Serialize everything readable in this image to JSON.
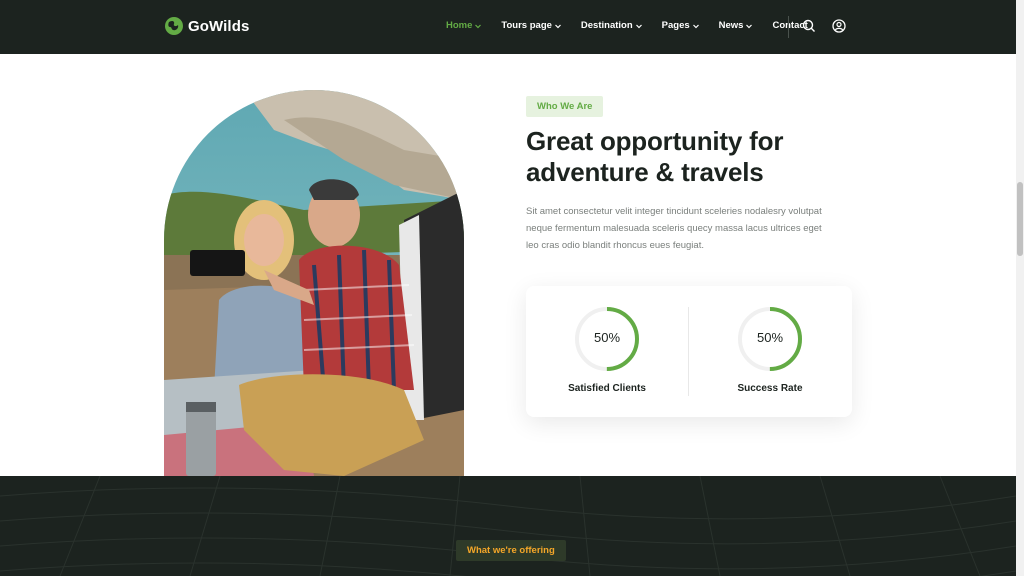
{
  "brand": {
    "name": "GoWilds",
    "accent": "#63ab45",
    "dark": "#1c231f"
  },
  "nav": {
    "items": [
      {
        "label": "Home",
        "active": true,
        "dropdown": true
      },
      {
        "label": "Tours page",
        "active": false,
        "dropdown": true
      },
      {
        "label": "Destination",
        "active": false,
        "dropdown": true
      },
      {
        "label": "Pages",
        "active": false,
        "dropdown": true
      },
      {
        "label": "News",
        "active": false,
        "dropdown": true
      },
      {
        "label": "Contact",
        "active": false,
        "dropdown": false
      }
    ],
    "icons": [
      "search-icon",
      "user-icon"
    ]
  },
  "about": {
    "tag": "Who We Are",
    "headline_line1": "Great opportunity for",
    "headline_line2": "adventure & travels",
    "paragraph": "Sit amet consectetur velit integer tincidunt sceleries nodalesry volutpat neque fermentum malesuada sceleris quecy massa lacus ultrices eget leo cras odio blandit rhoncus eues feugiat."
  },
  "stats": [
    {
      "value": "50%",
      "percent": 50,
      "label": "Satisfied Clients"
    },
    {
      "value": "50%",
      "percent": 50,
      "label": "Success Rate"
    }
  ],
  "offering": {
    "tag": "What we're offering",
    "tag_color": "#f4a629"
  }
}
